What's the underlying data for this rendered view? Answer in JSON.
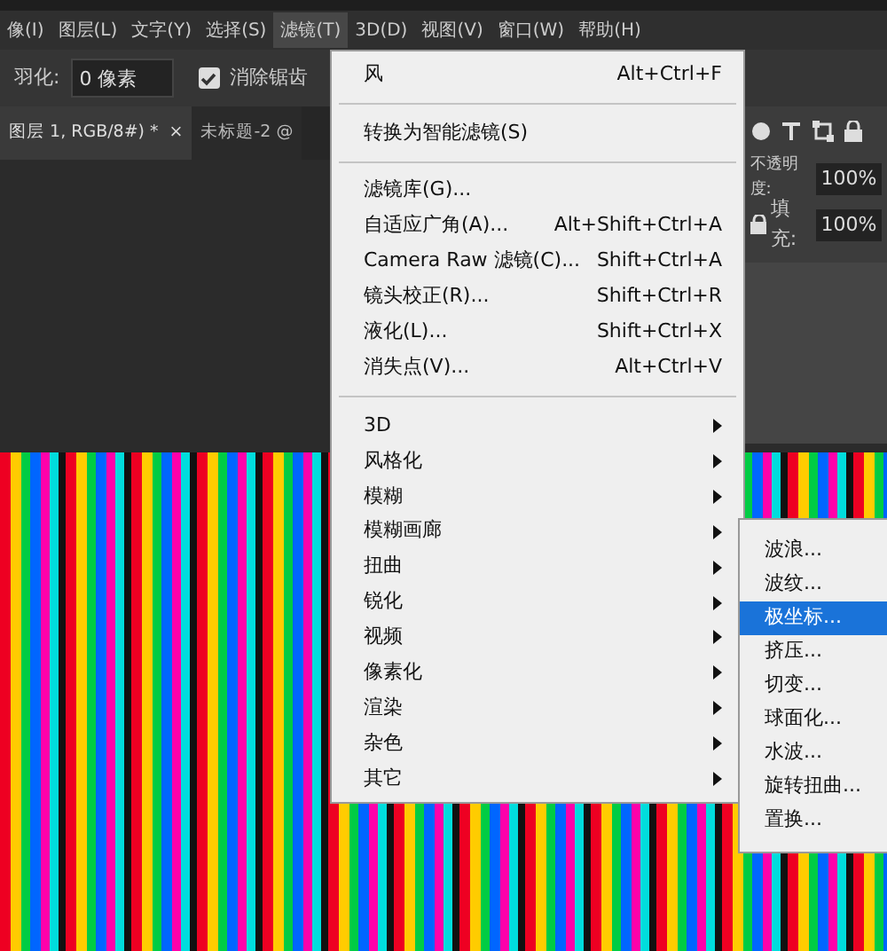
{
  "menu_bar": [
    {
      "label": "像(I)",
      "selected": false
    },
    {
      "label": "图层(L)",
      "selected": false
    },
    {
      "label": "文字(Y)",
      "selected": false
    },
    {
      "label": "选择(S)",
      "selected": false
    },
    {
      "label": "滤镜(T)",
      "selected": true
    },
    {
      "label": "3D(D)",
      "selected": false
    },
    {
      "label": "视图(V)",
      "selected": false
    },
    {
      "label": "窗口(W)",
      "selected": false
    },
    {
      "label": "帮助(H)",
      "selected": false
    }
  ],
  "options_bar": {
    "feather_label": "羽化:",
    "feather_value": "0 像素",
    "anti_alias": {
      "label": "消除锯齿",
      "checked": true
    }
  },
  "document_tabs": [
    {
      "label": "图层 1, RGB/8#) *",
      "close": "×",
      "selected": true
    },
    {
      "label": "未标题-2 @",
      "selected": false
    }
  ],
  "layers_panel": {
    "opacity_label": "不透明度:",
    "opacity_value": "100%",
    "fill_label": "填充:",
    "fill_value": "100%"
  },
  "filter_menu": [
    {
      "kind": "item",
      "label": "风",
      "shortcut": "Alt+Ctrl+F"
    },
    {
      "kind": "separator"
    },
    {
      "kind": "item",
      "label": "转换为智能滤镜(S)"
    },
    {
      "kind": "separator"
    },
    {
      "kind": "item",
      "label": "滤镜库(G)..."
    },
    {
      "kind": "item",
      "label": "自适应广角(A)...",
      "shortcut": "Alt+Shift+Ctrl+A"
    },
    {
      "kind": "item",
      "label": "Camera Raw 滤镜(C)...",
      "shortcut": "Shift+Ctrl+A"
    },
    {
      "kind": "item",
      "label": "镜头校正(R)...",
      "shortcut": "Shift+Ctrl+R"
    },
    {
      "kind": "item",
      "label": "液化(L)...",
      "shortcut": "Shift+Ctrl+X"
    },
    {
      "kind": "item",
      "label": "消失点(V)...",
      "shortcut": "Alt+Ctrl+V"
    },
    {
      "kind": "separator"
    },
    {
      "kind": "submenu",
      "label": "3D"
    },
    {
      "kind": "submenu",
      "label": "风格化"
    },
    {
      "kind": "submenu",
      "label": "模糊"
    },
    {
      "kind": "submenu",
      "label": "模糊画廊"
    },
    {
      "kind": "submenu",
      "label": "扭曲"
    },
    {
      "kind": "submenu",
      "label": "锐化"
    },
    {
      "kind": "submenu",
      "label": "视频"
    },
    {
      "kind": "submenu",
      "label": "像素化"
    },
    {
      "kind": "submenu",
      "label": "渲染"
    },
    {
      "kind": "submenu",
      "label": "杂色"
    },
    {
      "kind": "submenu",
      "label": "其它"
    }
  ],
  "distort_submenu": [
    {
      "label": "波浪...",
      "selected": false
    },
    {
      "label": "波纹...",
      "selected": false
    },
    {
      "label": "极坐标...",
      "selected": true
    },
    {
      "label": "挤压...",
      "selected": false
    },
    {
      "label": "切变...",
      "selected": false
    },
    {
      "label": "球面化...",
      "selected": false
    },
    {
      "label": "水波...",
      "selected": false
    },
    {
      "label": "旋转扭曲...",
      "selected": false
    },
    {
      "label": "置换...",
      "selected": false
    }
  ]
}
